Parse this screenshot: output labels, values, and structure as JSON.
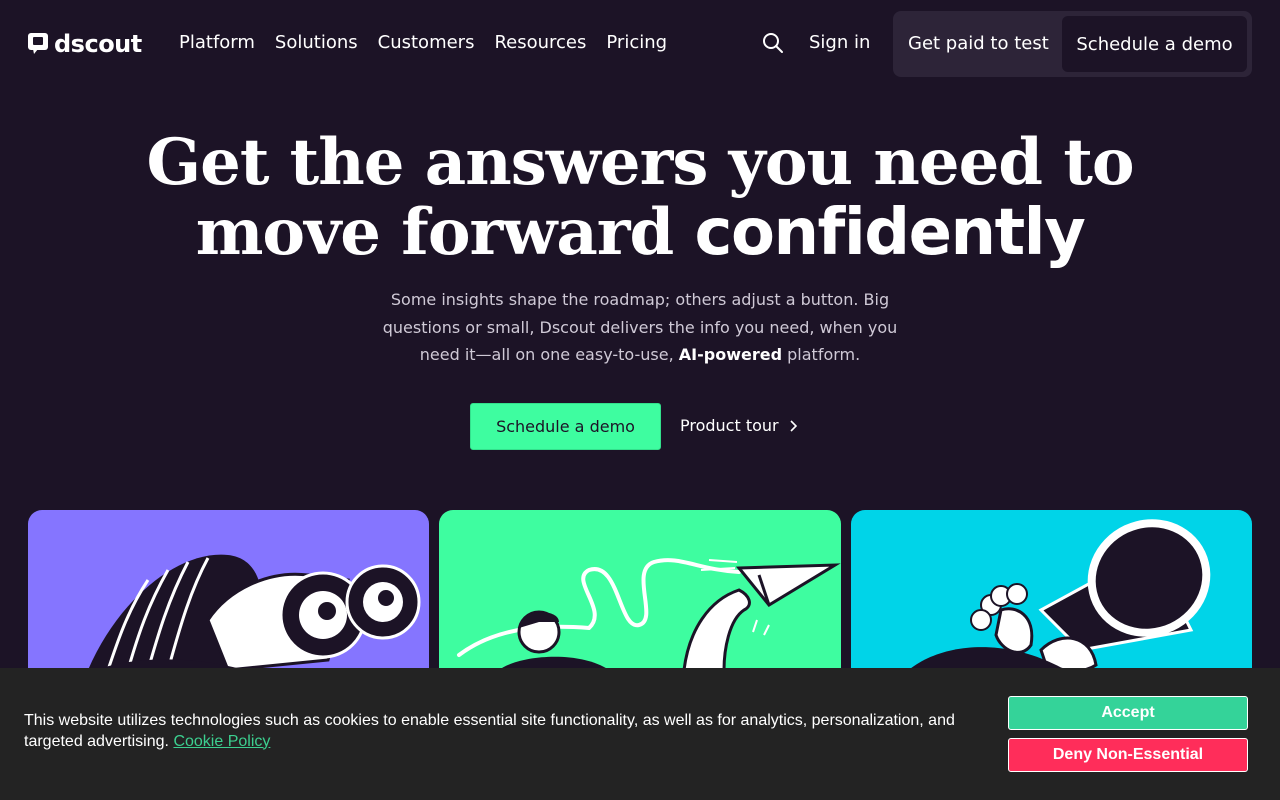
{
  "header": {
    "logo_text": "dscout",
    "nav": [
      {
        "label": "Platform"
      },
      {
        "label": "Solutions"
      },
      {
        "label": "Customers"
      },
      {
        "label": "Resources"
      },
      {
        "label": "Pricing"
      }
    ],
    "search_icon": "search-icon",
    "sign_in": "Sign in",
    "get_paid": "Get paid to test",
    "schedule_demo": "Schedule a demo"
  },
  "hero": {
    "title_line1": "Get the answers you need to",
    "title_line2_regular": "move forward",
    "title_line2_bold": "confidently",
    "subtitle_part1": "Some insights shape the roadmap; others adjust a button. Big questions or small, Dscout delivers the info you need, when you need it—all on one easy-to-use,",
    "subtitle_bold": "AI-powered",
    "subtitle_part2": "platform.",
    "primary_cta": "Schedule a demo",
    "secondary_cta": "Product tour",
    "secondary_icon": "chevron-right-icon"
  },
  "cards": [
    {
      "name": "binoculars-illustration",
      "bg": "#8575ff"
    },
    {
      "name": "paper-plane-illustration",
      "bg": "#3efda0"
    },
    {
      "name": "telescope-illustration",
      "bg": "#00d4e8"
    }
  ],
  "cookie_banner": {
    "text": "This website utilizes technologies such as cookies to enable essential site functionality, as well as for analytics, personalization, and targeted advertising.",
    "link": "Cookie Policy",
    "accept": "Accept",
    "deny": "Deny Non-Essential"
  },
  "colors": {
    "background": "#1c1326",
    "accent_green": "#3efda0",
    "cookie_accept": "#34d399",
    "cookie_deny": "#ff2d5a",
    "cookie_link": "#3ccf8f"
  }
}
